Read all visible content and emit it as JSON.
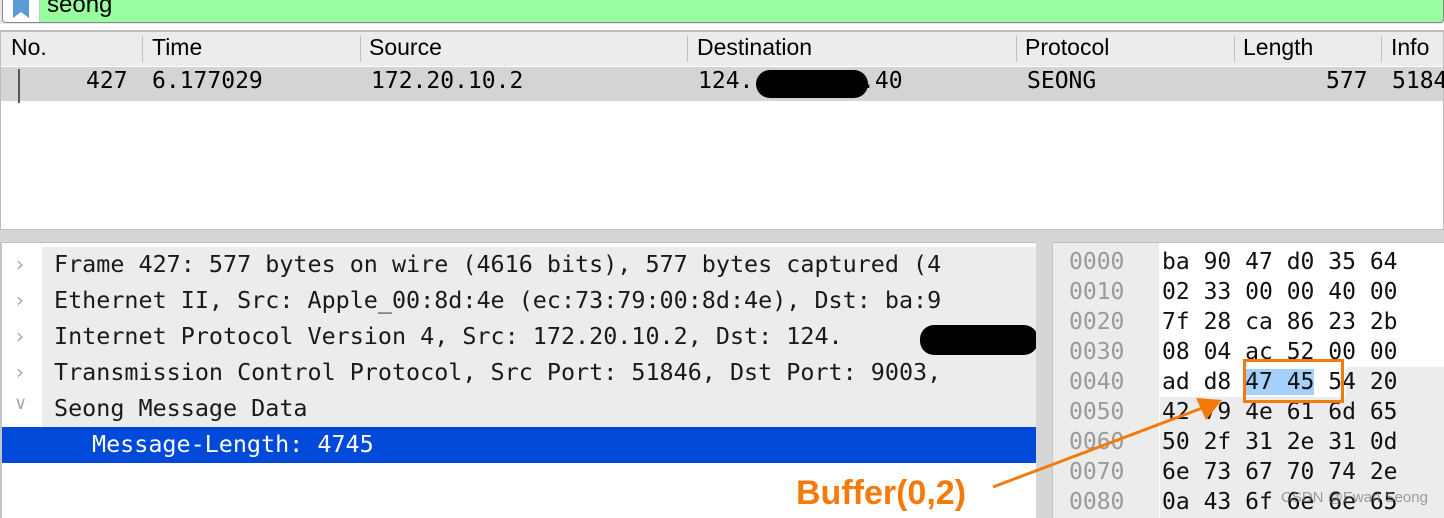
{
  "filter": {
    "value": "seong",
    "icon": "bookmark-icon",
    "background_color": "#99fe9f"
  },
  "packet_list": {
    "columns": [
      "No.",
      "Time",
      "Source",
      "Destination",
      "Protocol",
      "Length",
      "Info"
    ],
    "rows": [
      {
        "no": "427",
        "time": "6.177029",
        "source": "172.20.10.2",
        "destination_prefix": "124.",
        "destination_suffix": ".40",
        "protocol": "SEONG",
        "length": "577",
        "info": "5184"
      }
    ]
  },
  "details": {
    "items": [
      {
        "label": "Frame 427: 577 bytes on wire (4616 bits), 577 bytes captured (4",
        "expanded": false,
        "icon": "chevron-right-icon"
      },
      {
        "label": "Ethernet II, Src: Apple_00:8d:4e (ec:73:79:00:8d:4e), Dst: ba:9",
        "expanded": false,
        "icon": "chevron-right-icon"
      },
      {
        "label": "Internet Protocol Version 4, Src: 172.20.10.2, Dst: 124.",
        "expanded": false,
        "icon": "chevron-right-icon"
      },
      {
        "label": "Transmission Control Protocol, Src Port: 51846, Dst Port: 9003,",
        "expanded": false,
        "icon": "chevron-right-icon"
      },
      {
        "label": "Seong Message Data",
        "expanded": true,
        "icon": "chevron-down-icon"
      },
      {
        "label": "Message-Length: 4745",
        "selected": true
      }
    ],
    "selected_color": "#0049d9"
  },
  "bytes": {
    "rows": [
      {
        "offset": "0000",
        "bytes": [
          "ba",
          "90",
          "47",
          "d0",
          "35",
          "64"
        ]
      },
      {
        "offset": "0010",
        "bytes": [
          "02",
          "33",
          "00",
          "00",
          "40",
          "00"
        ]
      },
      {
        "offset": "0020",
        "bytes": [
          "7f",
          "28",
          "ca",
          "86",
          "23",
          "2b"
        ]
      },
      {
        "offset": "0030",
        "bytes": [
          "08",
          "04",
          "ac",
          "52",
          "00",
          "00"
        ]
      },
      {
        "offset": "0040",
        "bytes": [
          "ad",
          "d8",
          "47",
          "45",
          "54",
          "20"
        ]
      },
      {
        "offset": "0050",
        "bytes": [
          "42",
          "79",
          "4e",
          "61",
          "6d",
          "65"
        ]
      },
      {
        "offset": "0060",
        "bytes": [
          "50",
          "2f",
          "31",
          "2e",
          "31",
          "0d"
        ]
      },
      {
        "offset": "0070",
        "bytes": [
          "6e",
          "73",
          "67",
          "70",
          "74",
          "2e"
        ]
      },
      {
        "offset": "0080",
        "bytes": [
          "0a",
          "43",
          "6f",
          "6e",
          "6e",
          "65"
        ]
      }
    ],
    "highlight_color": "#a5d0fb"
  },
  "annotation": {
    "label": "Buffer(0,2)",
    "color": "#f57a0c"
  },
  "watermark": "CSDN @Ewan Seong"
}
